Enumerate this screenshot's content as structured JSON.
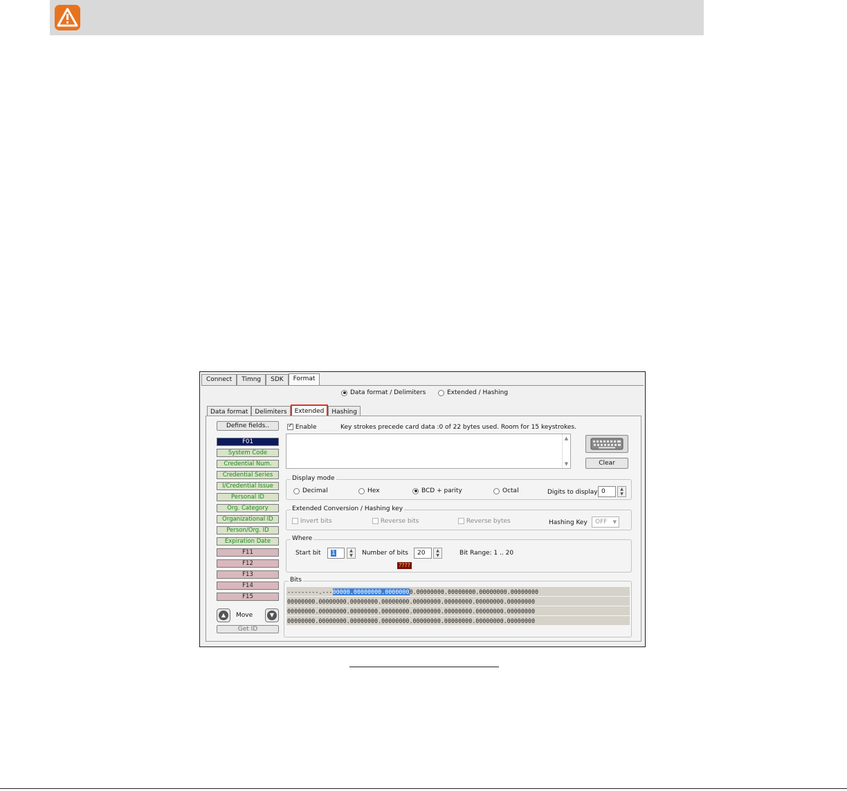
{
  "warning": {
    "icon": "warning-triangle-icon",
    "color": "#e8731f"
  },
  "window": {
    "top_tabs": [
      {
        "label": "Connect",
        "active": false
      },
      {
        "label": "Timng",
        "active": false
      },
      {
        "label": "SDK",
        "active": false
      },
      {
        "label": "Format",
        "active": true
      }
    ],
    "mode_options": [
      {
        "label": "Data format / Delimiters",
        "selected": true
      },
      {
        "label": "Extended / Hashing",
        "selected": false
      }
    ],
    "sub_tabs": [
      {
        "label": "Data format",
        "active": false
      },
      {
        "label": "Delimiters",
        "active": false
      },
      {
        "label": "Extended",
        "active": true,
        "highlight_color": "#d9342b"
      },
      {
        "label": "Hashing",
        "active": false
      }
    ],
    "define_fields_label": "Define fields..",
    "fields": [
      {
        "label": "F01",
        "style": "selected"
      },
      {
        "label": "System Code",
        "style": "green"
      },
      {
        "label": "Credential Num.",
        "style": "green"
      },
      {
        "label": "Credential Series",
        "style": "green"
      },
      {
        "label": "I/Credential Issue",
        "style": "green"
      },
      {
        "label": "Personal ID",
        "style": "green"
      },
      {
        "label": "Org. Category",
        "style": "green"
      },
      {
        "label": "Organizational ID",
        "style": "green"
      },
      {
        "label": "Person/Org. ID",
        "style": "green"
      },
      {
        "label": "Expiration Date",
        "style": "green"
      },
      {
        "label": "F11",
        "style": "pink"
      },
      {
        "label": "F12",
        "style": "pink"
      },
      {
        "label": "F13",
        "style": "pink"
      },
      {
        "label": "F14",
        "style": "pink"
      },
      {
        "label": "F15",
        "style": "pink"
      }
    ],
    "move_label": "Move",
    "get_id_label": "Get ID",
    "enable_label": "Enable",
    "enable_checked": true,
    "keystroke_info": "Key strokes precede card data :0 of 22 bytes used. Room for 15 keystrokes.",
    "clear_label": "Clear",
    "display_mode": {
      "title": "Display mode",
      "options": [
        {
          "label": "Decimal",
          "selected": false
        },
        {
          "label": "Hex",
          "selected": false
        },
        {
          "label": "BCD + parity",
          "selected": true
        },
        {
          "label": "Octal",
          "selected": false
        }
      ],
      "digits_label": "Digits to display",
      "digits_value": "0"
    },
    "conversion": {
      "title": "Extended Conversion / Hashing key",
      "invert_label": "Invert bits",
      "reverse_bits_label": "Reverse bits",
      "reverse_bytes_label": "Reverse bytes",
      "hashing_key_label": "Hashing Key",
      "hashing_key_value": "OFF"
    },
    "where": {
      "title": "Where",
      "start_bit_label": "Start bit",
      "start_bit_value": "1",
      "num_bits_label": "Number of bits",
      "num_bits_value": "20",
      "bit_range": "Bit Range: 1 .. 20",
      "status_badge": "????"
    },
    "bits": {
      "title": "Bits",
      "row1_prefix": "---------.---",
      "row1_highlight": "00000.00000000.0000000",
      "row1_suffix": "0.00000000.00000000.00000000.00000000",
      "rows": [
        "00000000.00000000.00000000.00000000.00000000.00000000.00000000.00000000",
        "00000000.00000000.00000000.00000000.00000000.00000000.00000000.00000000",
        "00000000.00000000.00000000.00000000.00000000.00000000.00000000.00000000"
      ]
    }
  }
}
